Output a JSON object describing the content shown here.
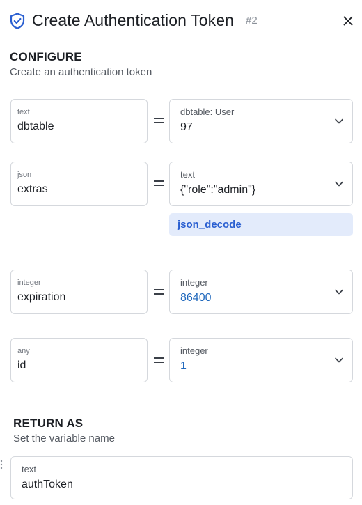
{
  "header": {
    "title": "Create Authentication Token",
    "step": "#2"
  },
  "configure": {
    "title": "CONFIGURE",
    "subtitle": "Create an authentication token"
  },
  "rows": [
    {
      "left_type": "text",
      "left_value": "dbtable",
      "right_type": "dbtable: User",
      "right_value": "97"
    },
    {
      "left_type": "json",
      "left_value": "extras",
      "right_type": "text",
      "right_value": "{\"role\":\"admin\"}",
      "filter": "json_decode"
    },
    {
      "left_type": "integer",
      "left_value": "expiration",
      "right_type": "integer",
      "right_value": "86400"
    },
    {
      "left_type": "any",
      "left_value": "id",
      "right_type": "integer",
      "right_value": "1"
    }
  ],
  "return_as": {
    "title": "RETURN AS",
    "subtitle": "Set the variable name",
    "type": "text",
    "value": "authToken"
  },
  "colors": {
    "accent": "#2a5fd1",
    "number": "#2169bd",
    "chip_bg": "#e3ebfb"
  }
}
